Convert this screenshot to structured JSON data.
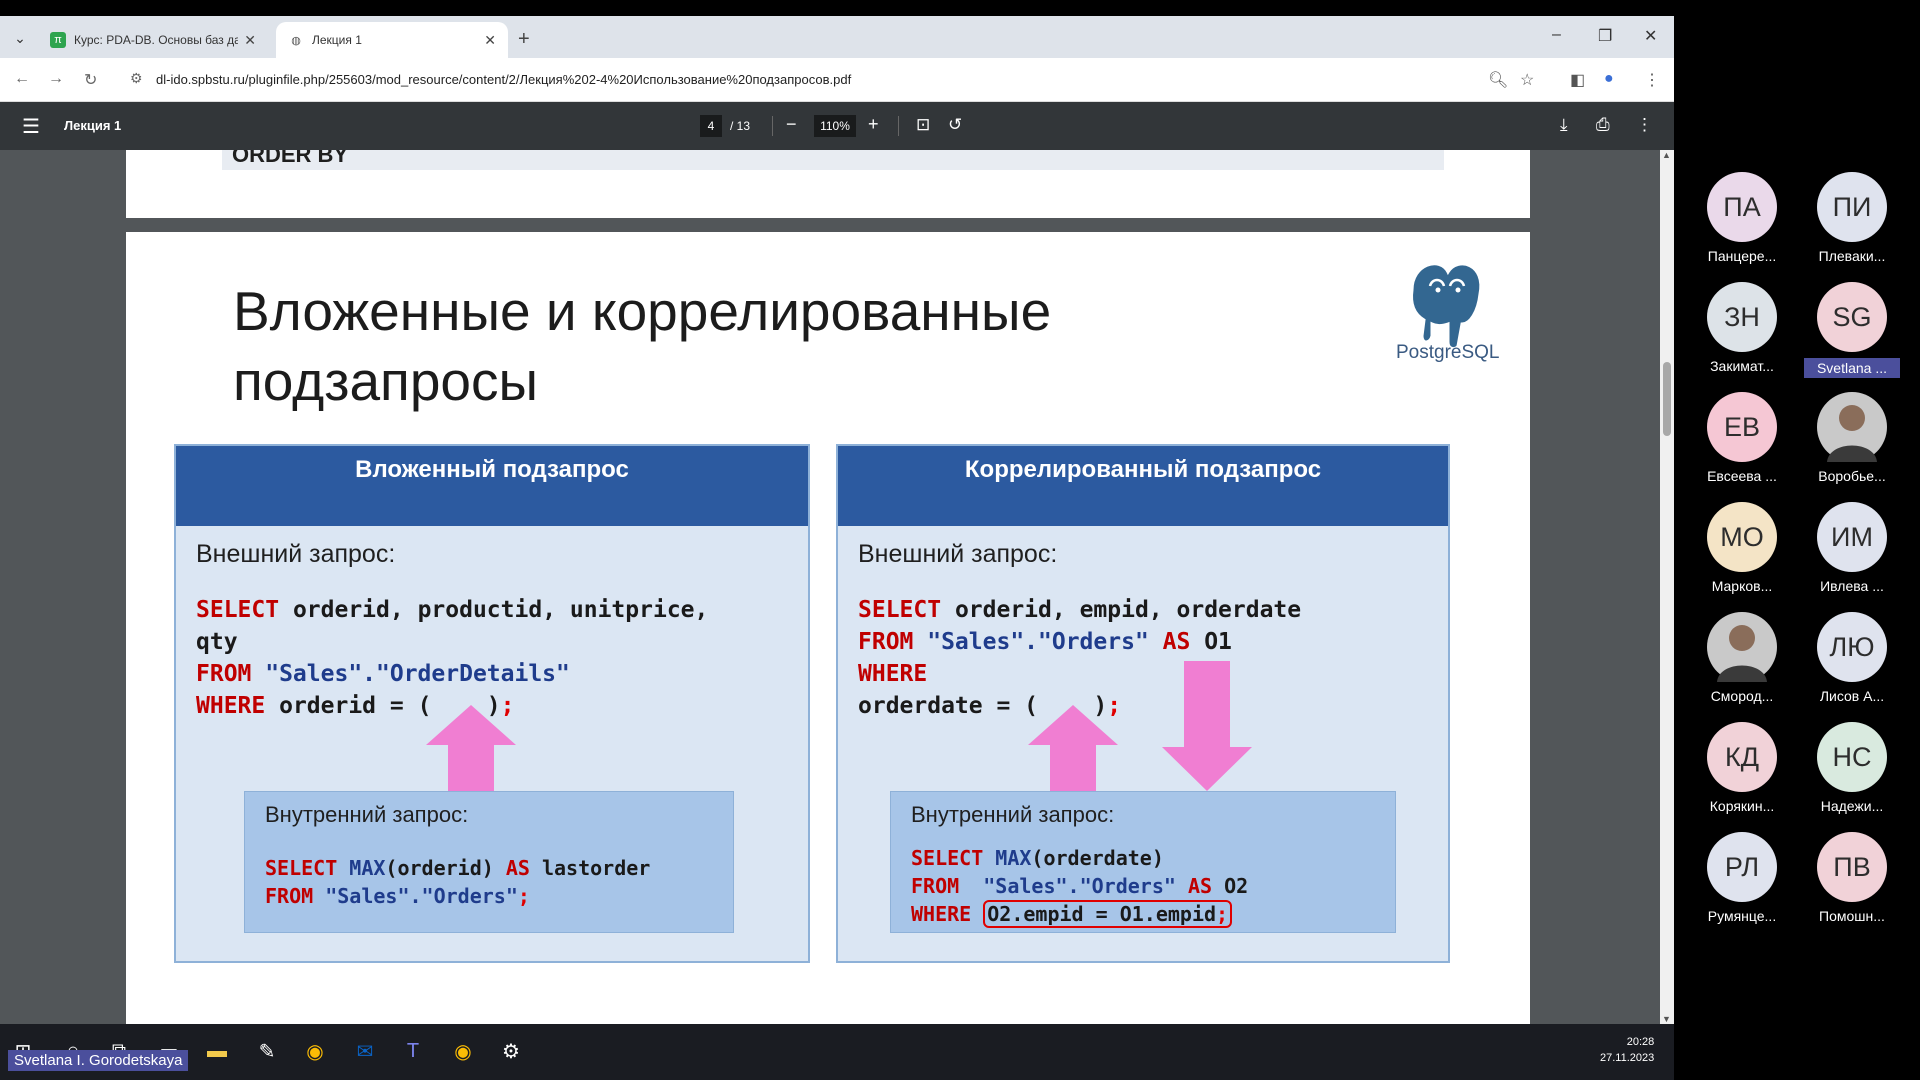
{
  "browser": {
    "tabs": [
      {
        "title": "Курс: PDA-DB. Основы баз да",
        "active": false,
        "favicon": "green-pi-icon"
      },
      {
        "title": "Лекция 1",
        "active": true,
        "favicon": "globe-icon"
      }
    ],
    "url": "dl-ido.spbstu.ru/pluginfile.php/255603/mod_resource/content/2/Лекция%202-4%20Использование%20подзапросов.pdf"
  },
  "pdf_viewer": {
    "title": "Лекция 1",
    "current_page": "4",
    "total_pages": "/ 13",
    "zoom": "110%"
  },
  "prev_page": {
    "fragment": "ORDER BY"
  },
  "slide": {
    "title_line1": "Вложенные и коррелированные",
    "title_line2": "подзапросы",
    "logo_text": "PostgreSQL",
    "left": {
      "heading": "Вложенный подзапрос",
      "outer_label": "Внешний запрос:",
      "outer_code": {
        "l1_kw": "SELECT",
        "l1_rest": " orderid, productid, unitprice,",
        "l2": "qty",
        "l3_kw": "FROM",
        "l3_str": " \"Sales\".\"OrderDetails\"",
        "l4_kw": "WHERE",
        "l4_rest": " orderid = (    )",
        "l4_semi": ";"
      },
      "inner_label": "Внутренний запрос:",
      "inner_code": {
        "l1_kw": "SELECT",
        "l1_fn": " MAX",
        "l1_rest": "(orderid) ",
        "l1_kw2": "AS",
        "l1_rest2": " lastorder",
        "l2_kw": "FROM",
        "l2_str": " \"Sales\".\"Orders\"",
        "l2_semi": ";"
      }
    },
    "right": {
      "heading": "Коррелированный подзапрос",
      "outer_label": "Внешний запрос:",
      "outer_code": {
        "l1_kw": "SELECT",
        "l1_rest": " orderid, empid, orderdate",
        "l2_kw": "FROM",
        "l2_str": " \"Sales\".\"Orders\" ",
        "l2_kw2": "AS",
        "l2_rest": " O1",
        "l3_kw": "WHERE",
        "l4_rest": "orderdate = (    )",
        "l4_semi": ";"
      },
      "inner_label": "Внутренний запрос:",
      "inner_code": {
        "l1_kw": "SELECT",
        "l1_fn": " MAX",
        "l1_rest": "(orderdate)",
        "l2_kw": "FROM",
        "l2_str": "  \"Sales\".\"Orders\" ",
        "l2_kw2": "AS",
        "l2_rest": " O2",
        "l3_kw": "WHERE",
        "l3_hl": "O2.empid = O1.empid",
        "l3_semi": ";"
      }
    },
    "arrow_color": "#f07ed2"
  },
  "taskbar": {
    "time": "20:28",
    "date": "27.11.2023",
    "user_label": "Svetlana I. Gorodetskaya"
  },
  "participants": [
    {
      "initials": "ПА",
      "name": "Панцере...",
      "color": "#ead9ea"
    },
    {
      "initials": "ПИ",
      "name": "Плеваки...",
      "color": "#dfe3ee"
    },
    {
      "initials": "ЗН",
      "name": "Закимат...",
      "color": "#dde3e8"
    },
    {
      "initials": "SG",
      "name": "Svetlana ...",
      "color": "#f1d2d8",
      "selected": true
    },
    {
      "initials": "ЕВ",
      "name": "Евсеева ...",
      "color": "#f5c7d4"
    },
    {
      "initials": "",
      "name": "Воробье...",
      "color": "#c9c9c9",
      "photo": true
    },
    {
      "initials": "МО",
      "name": "Марков...",
      "color": "#f4e4c6"
    },
    {
      "initials": "ИМ",
      "name": "Ивлева ...",
      "color": "#dfe3ee"
    },
    {
      "initials": "",
      "name": "Смород...",
      "color": "#c9c9c9",
      "photo": true
    },
    {
      "initials": "ЛЮ",
      "name": "Лисов А...",
      "color": "#dfe3ee"
    },
    {
      "initials": "КД",
      "name": "Корякин...",
      "color": "#f1d2d8"
    },
    {
      "initials": "НС",
      "name": "Надежи...",
      "color": "#d9eadf"
    },
    {
      "initials": "РЛ",
      "name": "Румянце...",
      "color": "#dfe3ee"
    },
    {
      "initials": "ПВ",
      "name": "Помошн...",
      "color": "#f1d2d8"
    }
  ]
}
